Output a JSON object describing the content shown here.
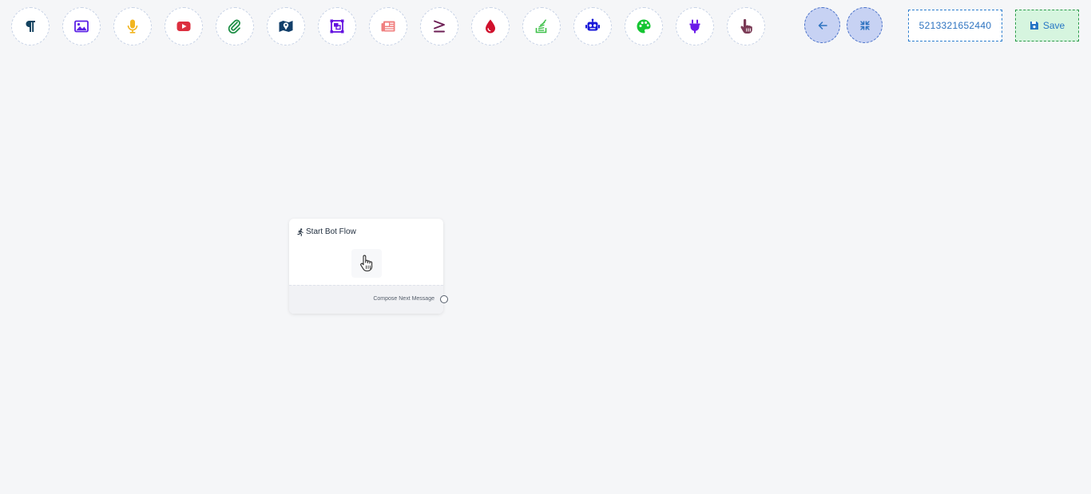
{
  "toolbar": {
    "tools": [
      {
        "icon": "paragraph-icon",
        "color": "#13425f"
      },
      {
        "icon": "image-icon",
        "color": "#5b21e6"
      },
      {
        "icon": "microphone-icon",
        "color": "#f2b51f"
      },
      {
        "icon": "youtube-icon",
        "color": "#dc2f3f"
      },
      {
        "icon": "paperclip-icon",
        "color": "#1e8f46"
      },
      {
        "icon": "map-icon",
        "color": "#123f6a"
      },
      {
        "icon": "object-group-icon",
        "color": "#6412e0"
      },
      {
        "icon": "newspaper-icon",
        "color": "#f07f7f"
      },
      {
        "icon": "greater-equal-icon",
        "color": "#6d1f55"
      },
      {
        "icon": "droplet-icon",
        "color": "#d0102c"
      },
      {
        "icon": "stack-overflow-icon",
        "color": "#3fc04a"
      },
      {
        "icon": "robot-icon",
        "color": "#1717d8"
      },
      {
        "icon": "palette-icon",
        "color": "#15c532"
      },
      {
        "icon": "plug-icon",
        "color": "#6a1ae8"
      },
      {
        "icon": "hand-pointer-icon",
        "color": "#7a3a55"
      }
    ]
  },
  "controls": {
    "back_icon": "arrow-left-icon",
    "fit_icon": "compress-icon"
  },
  "header": {
    "phone": "5213321652440",
    "save_label": "Save"
  },
  "flow": {
    "start_node": {
      "title": "Start Bot Flow",
      "footer_label": "Compose Next Message"
    }
  },
  "colors": {
    "background": "#f5f6f8",
    "accent_blue": "#2d73c0",
    "control_fill": "#c7d2f3",
    "save_fill": "#d6f5df"
  }
}
